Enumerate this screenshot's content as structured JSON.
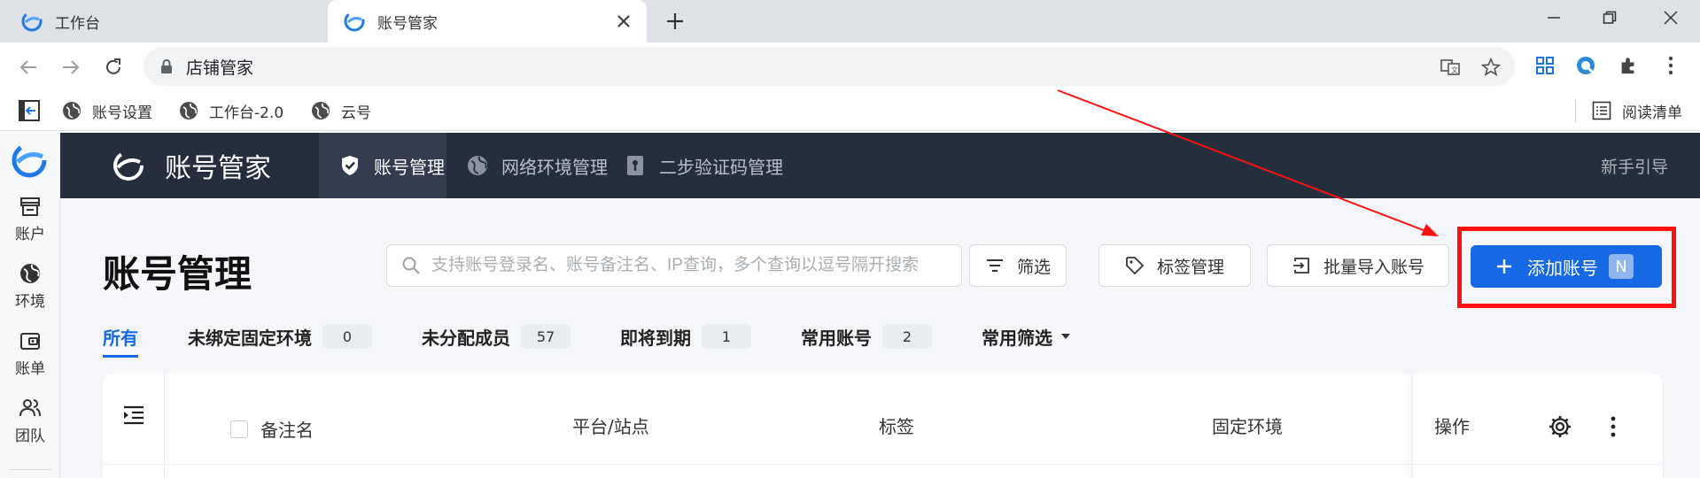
{
  "browser": {
    "tabs": [
      {
        "label": "工作台",
        "active": false
      },
      {
        "label": "账号管家",
        "active": true
      }
    ],
    "address": "店铺管家",
    "bookmarks": [
      {
        "label": "账号设置"
      },
      {
        "label": "工作台-2.0"
      },
      {
        "label": "云号"
      }
    ],
    "reading_list": "阅读清单"
  },
  "rail": {
    "items": [
      {
        "label": "账户",
        "icon": "store-icon"
      },
      {
        "label": "环境",
        "icon": "globe-icon"
      },
      {
        "label": "账单",
        "icon": "wallet-icon"
      },
      {
        "label": "团队",
        "icon": "team-icon"
      }
    ]
  },
  "header": {
    "brand": "账号管家",
    "nav": [
      {
        "label": "账号管理",
        "icon": "shield-icon",
        "active": true
      },
      {
        "label": "网络环境管理",
        "icon": "globe-icon",
        "active": false
      },
      {
        "label": "二步验证码管理",
        "icon": "keyhole-icon",
        "active": false
      }
    ],
    "guide": "新手引导"
  },
  "page": {
    "title": "账号管理",
    "search_placeholder": "支持账号登录名、账号备注名、IP查询，多个查询以逗号隔开搜索",
    "buttons": {
      "filter": "筛选",
      "tags": "标签管理",
      "import": "批量导入账号",
      "add": "添加账号",
      "add_shortcut": "N"
    },
    "filters": [
      {
        "label": "所有",
        "count": null,
        "active": true
      },
      {
        "label": "未绑定固定环境",
        "count": "0"
      },
      {
        "label": "未分配成员",
        "count": "57"
      },
      {
        "label": "即将到期",
        "count": "1"
      },
      {
        "label": "常用账号",
        "count": "2"
      },
      {
        "label": "常用筛选",
        "count": null,
        "dropdown": true
      }
    ],
    "table": {
      "columns": [
        "备注名",
        "平台/站点",
        "标签",
        "固定环境"
      ],
      "ops_label": "操作"
    }
  },
  "colors": {
    "primary": "#1768e5",
    "header_bg": "#252e3d",
    "highlight": "#ff1010"
  }
}
